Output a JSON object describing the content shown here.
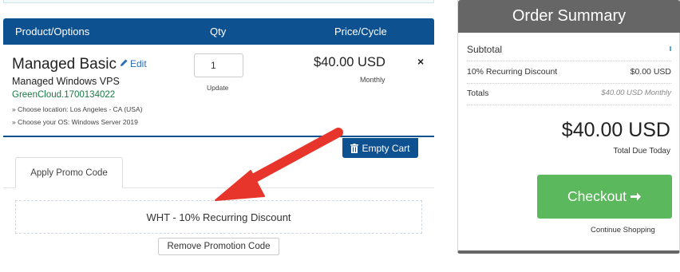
{
  "cart": {
    "header": {
      "product_col": "Product/Options",
      "qty_col": "Qty",
      "price_col": "Price/Cycle"
    },
    "item": {
      "name": "Managed Basic",
      "edit_label": "Edit",
      "subtitle": "Managed Windows VPS",
      "hostname": "GreenCloud.1700134022",
      "options": [
        "» Choose location: Los Angeles - CA (USA)",
        "» Choose your OS: Windows Server 2019"
      ],
      "qty_value": "1",
      "update_label": "Update",
      "price": "$40.00 USD",
      "cycle": "Monthly",
      "remove_symbol": "×"
    },
    "empty_cart_label": "Empty Cart",
    "promo_tab_label": "Apply Promo Code",
    "applied_promo": "WHT - 10% Recurring Discount",
    "remove_promo_label": "Remove Promotion Code"
  },
  "summary": {
    "title": "Order Summary",
    "subtotal_label": "Subtotal",
    "discount_label": "10% Recurring Discount",
    "discount_value": "$0.00 USD",
    "totals_label": "Totals",
    "totals_value": "$40.00 USD Monthly",
    "total_due_amount": "$40.00 USD",
    "total_due_label": "Total Due Today",
    "checkout_label": "Checkout",
    "continue_label": "Continue Shopping"
  },
  "colors": {
    "brand_blue": "#0e5191",
    "checkout_green": "#5cb85c",
    "arrow_red": "#e8352b",
    "summary_gray": "#666666"
  },
  "icons": [
    "pencil-icon",
    "close-icon",
    "trash-icon",
    "arrow-right-icon",
    "annotation-arrow"
  ]
}
